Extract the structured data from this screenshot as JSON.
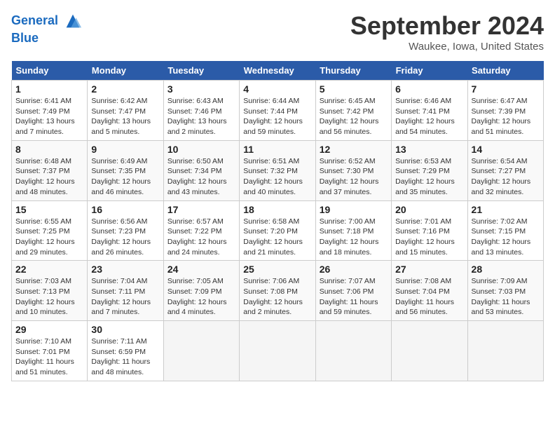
{
  "header": {
    "logo_text_1": "General",
    "logo_text_2": "Blue",
    "month": "September 2024",
    "location": "Waukee, Iowa, United States"
  },
  "calendar": {
    "days_of_week": [
      "Sunday",
      "Monday",
      "Tuesday",
      "Wednesday",
      "Thursday",
      "Friday",
      "Saturday"
    ],
    "weeks": [
      [
        {
          "day": "1",
          "info": "Sunrise: 6:41 AM\nSunset: 7:49 PM\nDaylight: 13 hours and 7 minutes."
        },
        {
          "day": "2",
          "info": "Sunrise: 6:42 AM\nSunset: 7:47 PM\nDaylight: 13 hours and 5 minutes."
        },
        {
          "day": "3",
          "info": "Sunrise: 6:43 AM\nSunset: 7:46 PM\nDaylight: 13 hours and 2 minutes."
        },
        {
          "day": "4",
          "info": "Sunrise: 6:44 AM\nSunset: 7:44 PM\nDaylight: 12 hours and 59 minutes."
        },
        {
          "day": "5",
          "info": "Sunrise: 6:45 AM\nSunset: 7:42 PM\nDaylight: 12 hours and 56 minutes."
        },
        {
          "day": "6",
          "info": "Sunrise: 6:46 AM\nSunset: 7:41 PM\nDaylight: 12 hours and 54 minutes."
        },
        {
          "day": "7",
          "info": "Sunrise: 6:47 AM\nSunset: 7:39 PM\nDaylight: 12 hours and 51 minutes."
        }
      ],
      [
        {
          "day": "8",
          "info": "Sunrise: 6:48 AM\nSunset: 7:37 PM\nDaylight: 12 hours and 48 minutes."
        },
        {
          "day": "9",
          "info": "Sunrise: 6:49 AM\nSunset: 7:35 PM\nDaylight: 12 hours and 46 minutes."
        },
        {
          "day": "10",
          "info": "Sunrise: 6:50 AM\nSunset: 7:34 PM\nDaylight: 12 hours and 43 minutes."
        },
        {
          "day": "11",
          "info": "Sunrise: 6:51 AM\nSunset: 7:32 PM\nDaylight: 12 hours and 40 minutes."
        },
        {
          "day": "12",
          "info": "Sunrise: 6:52 AM\nSunset: 7:30 PM\nDaylight: 12 hours and 37 minutes."
        },
        {
          "day": "13",
          "info": "Sunrise: 6:53 AM\nSunset: 7:29 PM\nDaylight: 12 hours and 35 minutes."
        },
        {
          "day": "14",
          "info": "Sunrise: 6:54 AM\nSunset: 7:27 PM\nDaylight: 12 hours and 32 minutes."
        }
      ],
      [
        {
          "day": "15",
          "info": "Sunrise: 6:55 AM\nSunset: 7:25 PM\nDaylight: 12 hours and 29 minutes."
        },
        {
          "day": "16",
          "info": "Sunrise: 6:56 AM\nSunset: 7:23 PM\nDaylight: 12 hours and 26 minutes."
        },
        {
          "day": "17",
          "info": "Sunrise: 6:57 AM\nSunset: 7:22 PM\nDaylight: 12 hours and 24 minutes."
        },
        {
          "day": "18",
          "info": "Sunrise: 6:58 AM\nSunset: 7:20 PM\nDaylight: 12 hours and 21 minutes."
        },
        {
          "day": "19",
          "info": "Sunrise: 7:00 AM\nSunset: 7:18 PM\nDaylight: 12 hours and 18 minutes."
        },
        {
          "day": "20",
          "info": "Sunrise: 7:01 AM\nSunset: 7:16 PM\nDaylight: 12 hours and 15 minutes."
        },
        {
          "day": "21",
          "info": "Sunrise: 7:02 AM\nSunset: 7:15 PM\nDaylight: 12 hours and 13 minutes."
        }
      ],
      [
        {
          "day": "22",
          "info": "Sunrise: 7:03 AM\nSunset: 7:13 PM\nDaylight: 12 hours and 10 minutes."
        },
        {
          "day": "23",
          "info": "Sunrise: 7:04 AM\nSunset: 7:11 PM\nDaylight: 12 hours and 7 minutes."
        },
        {
          "day": "24",
          "info": "Sunrise: 7:05 AM\nSunset: 7:09 PM\nDaylight: 12 hours and 4 minutes."
        },
        {
          "day": "25",
          "info": "Sunrise: 7:06 AM\nSunset: 7:08 PM\nDaylight: 12 hours and 2 minutes."
        },
        {
          "day": "26",
          "info": "Sunrise: 7:07 AM\nSunset: 7:06 PM\nDaylight: 11 hours and 59 minutes."
        },
        {
          "day": "27",
          "info": "Sunrise: 7:08 AM\nSunset: 7:04 PM\nDaylight: 11 hours and 56 minutes."
        },
        {
          "day": "28",
          "info": "Sunrise: 7:09 AM\nSunset: 7:03 PM\nDaylight: 11 hours and 53 minutes."
        }
      ],
      [
        {
          "day": "29",
          "info": "Sunrise: 7:10 AM\nSunset: 7:01 PM\nDaylight: 11 hours and 51 minutes."
        },
        {
          "day": "30",
          "info": "Sunrise: 7:11 AM\nSunset: 6:59 PM\nDaylight: 11 hours and 48 minutes."
        },
        {
          "day": "",
          "info": ""
        },
        {
          "day": "",
          "info": ""
        },
        {
          "day": "",
          "info": ""
        },
        {
          "day": "",
          "info": ""
        },
        {
          "day": "",
          "info": ""
        }
      ]
    ]
  }
}
